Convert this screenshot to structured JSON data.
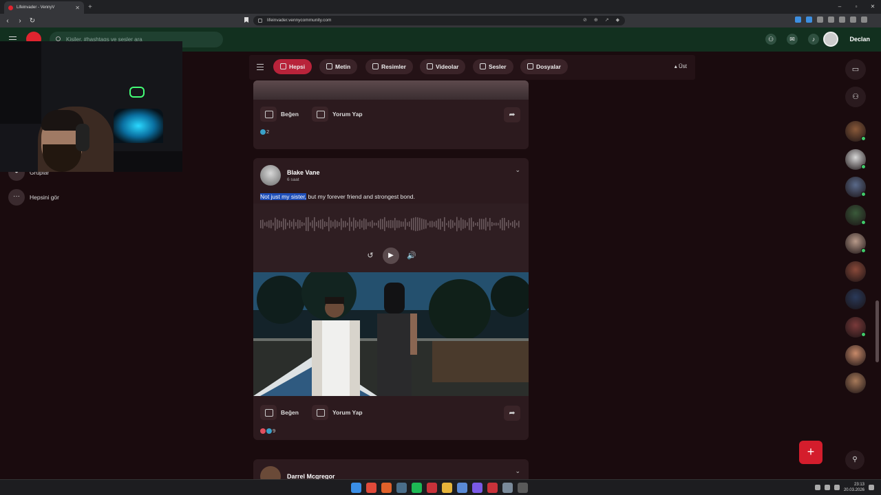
{
  "browser": {
    "tab_title": "Lifeinvader - VennyV",
    "new_tab": "+",
    "url": "lifeinvader.vennycommunity.com",
    "window_controls": [
      "–",
      "▫",
      "✕"
    ]
  },
  "header": {
    "search_placeholder": "Kişiler, #hashtags ve sesler ara",
    "user_name": "Declan",
    "icons": [
      "friends-icon",
      "messages-icon",
      "bell-icon"
    ]
  },
  "sidebar": {
    "items": [
      {
        "label": "Gruplar",
        "icon": "groups-icon"
      },
      {
        "label": "Hepsini gör",
        "icon": "more-dots-icon"
      }
    ]
  },
  "filters": {
    "chips": [
      {
        "label": "Hepsi",
        "icon": "all-icon",
        "active": true
      },
      {
        "label": "Metin",
        "icon": "text-icon",
        "active": false
      },
      {
        "label": "Resimler",
        "icon": "camera-icon",
        "active": false
      },
      {
        "label": "Videolar",
        "icon": "video-icon",
        "active": false
      },
      {
        "label": "Sesler",
        "icon": "music-icon",
        "active": false
      },
      {
        "label": "Dosyalar",
        "icon": "file-icon",
        "active": false
      }
    ],
    "top_label": "Üst"
  },
  "feed": {
    "like_label": "Beğen",
    "comment_label": "Yorum Yap",
    "post1": {
      "reaction_count": "2"
    },
    "post2": {
      "author": "Blake Vane",
      "time": "6 saat",
      "text_selected": "Not just my sister,",
      "text_rest": " but my forever friend and strongest bond.",
      "reaction_count": "9"
    },
    "post3": {
      "author": "Darrel Mcgregor"
    }
  },
  "fab": {
    "label": "+"
  },
  "taskbar": {
    "time": "23:13",
    "date": "20.03.2026"
  },
  "colors": {
    "accent": "#b8233a",
    "header_bg": "#12301f",
    "page_bg": "#1a0b0e",
    "card_bg": "#2c1a1e",
    "selection": "#1d4eb8",
    "online": "#3fca6a"
  }
}
